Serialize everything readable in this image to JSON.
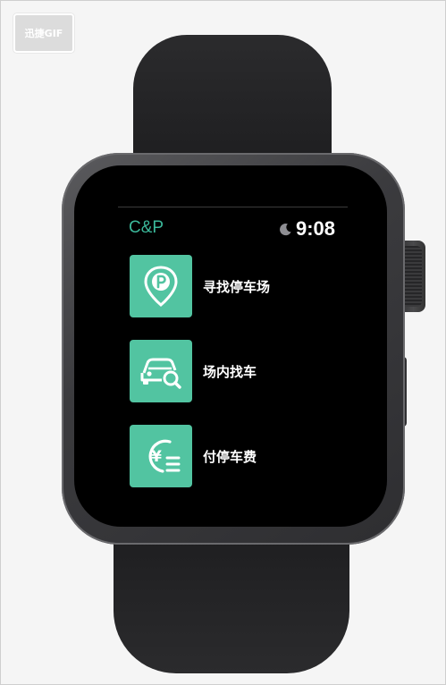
{
  "watermark": {
    "label": "迅捷GIF"
  },
  "status": {
    "app_name": "C&P",
    "time": "9:08",
    "moon_icon": "moon-icon"
  },
  "menu": {
    "items": [
      {
        "label": "寻找停车场",
        "icon": "parking-location-icon"
      },
      {
        "label": "场内找车",
        "icon": "car-search-icon"
      },
      {
        "label": "付停车费",
        "icon": "yuan-payment-icon"
      }
    ]
  },
  "colors": {
    "accent": "#52c4a1",
    "app_name": "#3bb89a",
    "screen": "#000000",
    "band": "#1f1f21"
  }
}
